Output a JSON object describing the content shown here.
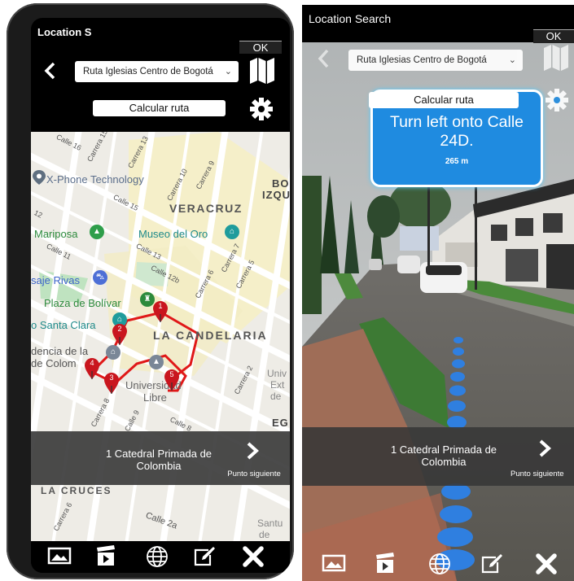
{
  "left": {
    "title": "Location S",
    "ok_label": "OK",
    "route_select": "Ruta Iglesias Centro de Bogotá",
    "calc_button": "Calcular ruta",
    "map_labels": {
      "carrera15": "Carrera 15",
      "calle16": "Calle 16",
      "carrera13": "Carrera 13",
      "xphone": "X-Phone Technology",
      "carrera10": "Carrera 10",
      "bo": "BO",
      "izq": "IZQU",
      "calle15": "Calle 15",
      "carrera9": "Carrera 9",
      "veracruz": "VERACRUZ",
      "calle12_label": "12",
      "mariposa": "Mariposa",
      "museo": "Museo del Oro",
      "calle11": "Calle 11",
      "calle13": "Calle 13",
      "carrera7": "Carrera 7",
      "saje": "saje Rivas",
      "calle12b": "Calle 12b",
      "carrera6": "Carrera 6",
      "carrera5": "Carrera 5",
      "plaza": "Plaza de Bolívar",
      "santaclara": "o Santa Clara",
      "candelaria": "LA CANDELARIA",
      "dencia": "dencia de la",
      "decolom": "de Colom",
      "universidad": "Universidad",
      "libre": "Libre",
      "carrera2": "Carrera 2",
      "univ": "Univ",
      "ext": "Ext",
      "de_label": "de",
      "carrera8": "Carrera 8",
      "calle9": "Calle 9",
      "calle8": "Calle 8",
      "eg": "EG",
      "lascruces": "LA CRUCES",
      "carrera6b": "Carrera 6",
      "calle2a": "Calle 2a",
      "santu": "Santu",
      "de2": "de"
    },
    "pins": [
      "1",
      "2",
      "3",
      "4",
      "5"
    ],
    "poi_name": "1 Catedral Primada de Colombia",
    "next_label": "Punto siguiente"
  },
  "right": {
    "title": "Location Search",
    "ok_label": "OK",
    "route_select": "Ruta Iglesias Centro de Bogotá",
    "calc_button": "Calcular ruta",
    "instruction": "Turn left onto Calle 24D.",
    "distance": "265 m",
    "poi_name": "1 Catedral Primada de Colombia",
    "next_label": "Punto siguiente"
  },
  "colors": {
    "route": "#e01818",
    "pin": "#c9161e",
    "nav_card": "#1f8be0",
    "ar_dots": "#2f7fe0"
  },
  "icons": [
    "back-arrow-icon",
    "map-icon",
    "gear-icon",
    "image-icon",
    "clapper-icon",
    "globe-icon",
    "edit-icon",
    "close-icon",
    "chevron-right-icon"
  ]
}
